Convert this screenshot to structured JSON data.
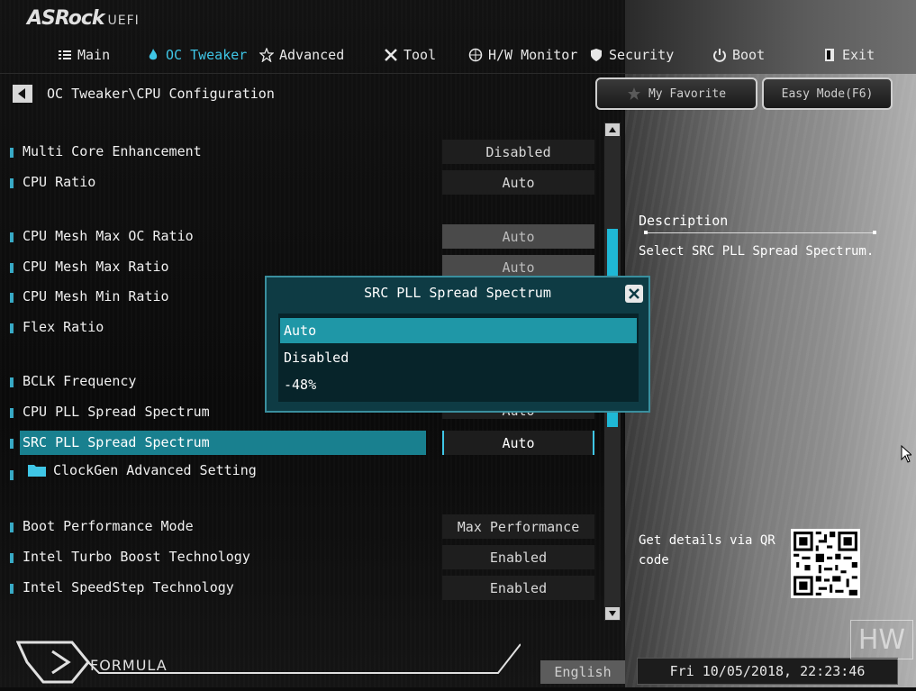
{
  "brand": {
    "name": "ASRock",
    "suffix": "UEFI"
  },
  "nav": [
    {
      "label": "Main",
      "icon": "list-icon",
      "active": false
    },
    {
      "label": "OC Tweaker",
      "icon": "flame-icon",
      "active": true
    },
    {
      "label": "Advanced",
      "icon": "star-icon",
      "active": false
    },
    {
      "label": "Tool",
      "icon": "tools-icon",
      "active": false
    },
    {
      "label": "H/W Monitor",
      "icon": "monitor-icon",
      "active": false
    },
    {
      "label": "Security",
      "icon": "shield-icon",
      "active": false
    },
    {
      "label": "Boot",
      "icon": "power-icon",
      "active": false
    },
    {
      "label": "Exit",
      "icon": "exit-icon",
      "active": false
    }
  ],
  "breadcrumb": "OC Tweaker\\CPU Configuration",
  "buttons": {
    "favorite": "My Favorite",
    "easy_mode": "Easy Mode(F6)"
  },
  "settings": [
    {
      "label": "Multi Core Enhancement",
      "value": "Disabled"
    },
    {
      "label": "CPU Ratio",
      "value": "Auto"
    },
    {
      "label": "CPU Mesh Max OC Ratio",
      "value": "Auto"
    },
    {
      "label": "CPU Mesh Max Ratio",
      "value": "Auto"
    },
    {
      "label": "CPU Mesh Min Ratio",
      "value": ""
    },
    {
      "label": "Flex Ratio",
      "value": ""
    },
    {
      "label": "BCLK Frequency",
      "value": ""
    },
    {
      "label": "CPU PLL Spread Spectrum",
      "value": "Auto"
    },
    {
      "label": "SRC PLL Spread Spectrum",
      "value": "Auto"
    },
    {
      "label": "ClockGen Advanced Setting",
      "value": ""
    },
    {
      "label": "Boot Performance Mode",
      "value": "Max Performance"
    },
    {
      "label": "Intel Turbo Boost Technology",
      "value": "Enabled"
    },
    {
      "label": "Intel SpeedStep Technology",
      "value": "Enabled"
    }
  ],
  "description": {
    "title": "Description",
    "text": "Select SRC PLL Spread Spectrum.",
    "qr_text": "Get details via QR code"
  },
  "popup": {
    "title": "SRC PLL Spread Spectrum",
    "options": [
      "Auto",
      "Disabled",
      "-48%"
    ],
    "selected": "Auto"
  },
  "footer": {
    "logo_text": "FORMULA",
    "language": "English",
    "datetime": "Fri 10/05/2018, 22:23:46"
  },
  "watermark": "HW",
  "colors": {
    "accent": "#3fc6e6",
    "selected_row": "#19808f",
    "popup_bg": "#0e3b44"
  }
}
